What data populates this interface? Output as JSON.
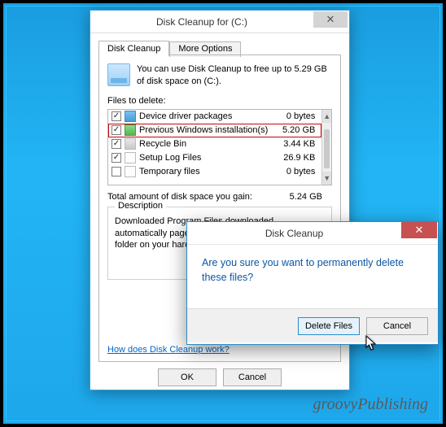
{
  "window": {
    "title": "Disk Cleanup for  (C:)",
    "tabs": {
      "cleanup": "Disk Cleanup",
      "more": "More Options"
    },
    "intro": "You can use Disk Cleanup to free up to 5.29 GB of disk space on  (C:).",
    "files_label": "Files to delete:",
    "rows": [
      {
        "name": "Device driver packages",
        "size": "0 bytes",
        "checked": true,
        "icon": "blue",
        "highlight": false
      },
      {
        "name": "Previous Windows installation(s)",
        "size": "5.20 GB",
        "checked": true,
        "icon": "green",
        "highlight": true
      },
      {
        "name": "Recycle Bin",
        "size": "3.44 KB",
        "checked": true,
        "icon": "bin",
        "highlight": false
      },
      {
        "name": "Setup Log Files",
        "size": "26.9 KB",
        "checked": true,
        "icon": "file",
        "highlight": false
      },
      {
        "name": "Temporary files",
        "size": "0 bytes",
        "checked": false,
        "icon": "file",
        "highlight": false
      }
    ],
    "total_label": "Total amount of disk space you gain:",
    "total_value": "5.24 GB",
    "desc_legend": "Description",
    "desc_text": "Downloaded Program Files downloaded automatically pages. They are temporarily Files folder on your hard disk.",
    "help_link": "How does Disk Cleanup work?",
    "ok": "OK",
    "cancel": "Cancel"
  },
  "confirm": {
    "title": "Disk Cleanup",
    "message": "Are you sure you want to permanently delete these files?",
    "primary": "Delete Files",
    "cancel": "Cancel"
  },
  "watermark": "groovyPublishing"
}
